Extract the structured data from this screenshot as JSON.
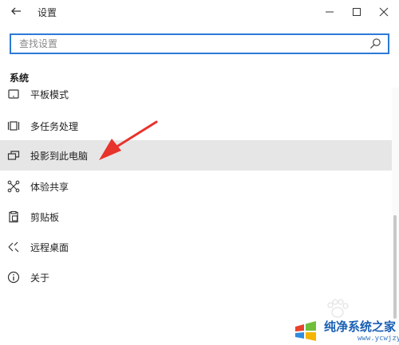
{
  "window": {
    "title": "设置"
  },
  "search": {
    "placeholder": "查找设置"
  },
  "section": {
    "title": "系统"
  },
  "items": [
    {
      "label": "平板模式",
      "icon": "tablet-mode-icon"
    },
    {
      "label": "多任务处理",
      "icon": "multitasking-icon"
    },
    {
      "label": "投影到此电脑",
      "icon": "project-to-pc-icon",
      "selected": true
    },
    {
      "label": "体验共享",
      "icon": "shared-experiences-icon"
    },
    {
      "label": "剪贴板",
      "icon": "clipboard-icon"
    },
    {
      "label": "远程桌面",
      "icon": "remote-desktop-icon"
    },
    {
      "label": "关于",
      "icon": "info-icon"
    }
  ],
  "watermark": {
    "main": "纯净系统之家",
    "url": "www.ycwjzy.com"
  },
  "colors": {
    "search_border": "#2d7ad6",
    "selected_bg": "#e6e6e6",
    "arrow": "#e8322c"
  }
}
